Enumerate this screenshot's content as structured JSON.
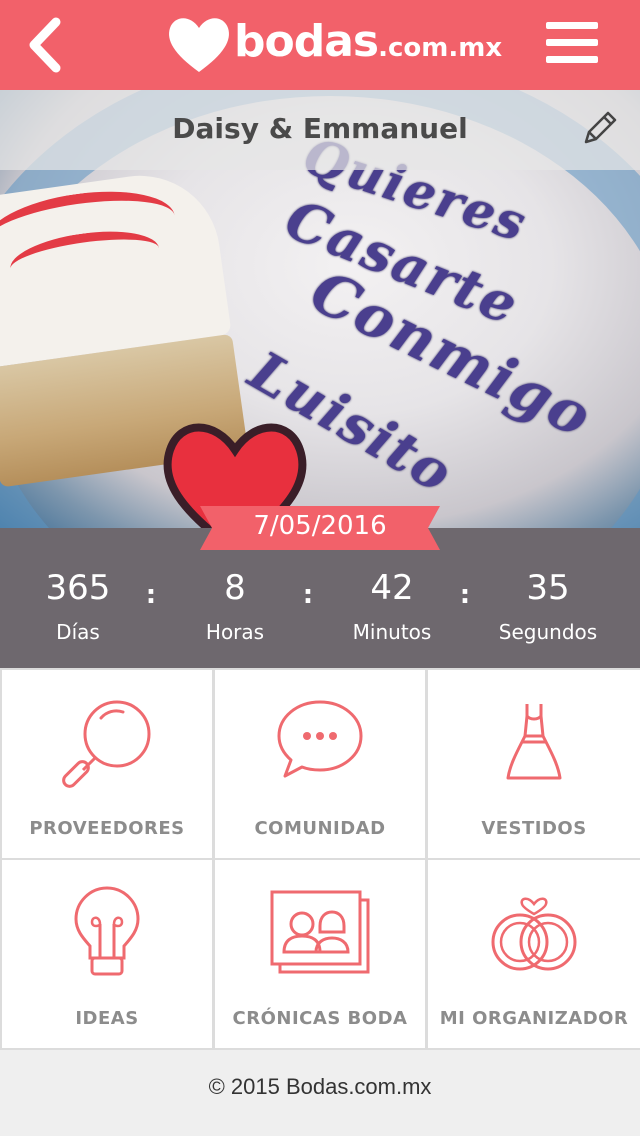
{
  "header": {
    "logo_main": "bodas",
    "logo_suffix": ".com.mx",
    "back_icon": "chevron-left-icon",
    "menu_icon": "hamburger-menu-icon",
    "brand_color": "#f2616a"
  },
  "hero": {
    "couple_name": "Daisy & Emmanuel",
    "edit_icon": "pencil-icon",
    "wedding_date": "7/05/2016"
  },
  "countdown": {
    "days": {
      "value": "365",
      "label": "Días"
    },
    "hours": {
      "value": "8",
      "label": "Horas"
    },
    "minutes": {
      "value": "42",
      "label": "Minutos"
    },
    "seconds": {
      "value": "35",
      "label": "Segundos"
    },
    "separator": ":"
  },
  "tiles": [
    {
      "label": "PROVEEDORES",
      "icon": "magnifier-icon"
    },
    {
      "label": "COMUNIDAD",
      "icon": "chat-bubble-icon"
    },
    {
      "label": "VESTIDOS",
      "icon": "dress-icon"
    },
    {
      "label": "IDEAS",
      "icon": "lightbulb-icon"
    },
    {
      "label": "CRÓNICAS BODA",
      "icon": "photo-couple-icon"
    },
    {
      "label": "MI ORGANIZADOR",
      "icon": "rings-icon"
    }
  ],
  "footer": {
    "copyright": "© 2015 Bodas.com.mx"
  }
}
